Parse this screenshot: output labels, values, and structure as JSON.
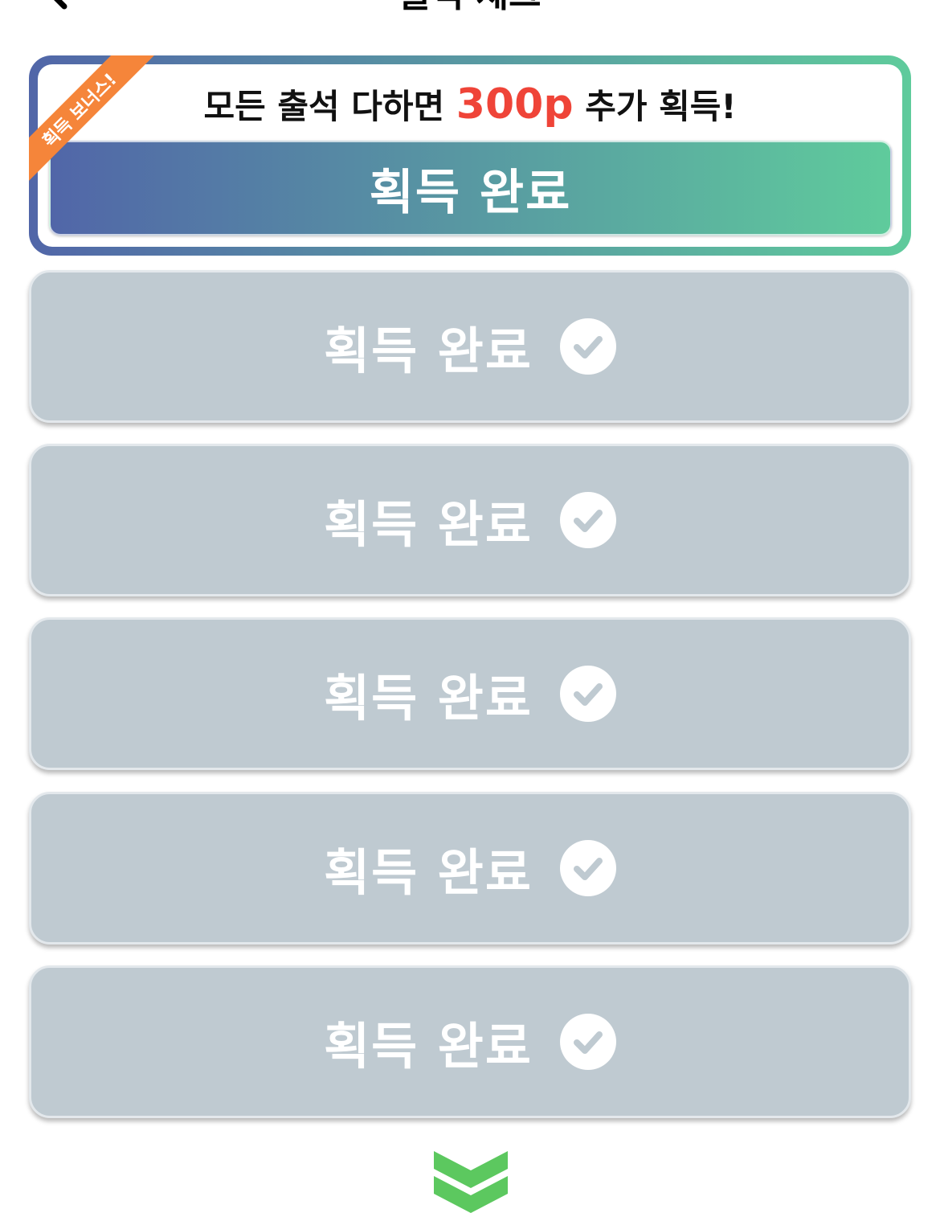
{
  "header": {
    "title": "출석 체크"
  },
  "bonus": {
    "ribbon_label": "획득 보너스!",
    "headline_prefix": "모든 출석 다하면 ",
    "headline_points": "300p",
    "headline_suffix": " 추가 획득!",
    "button_label": "획득 완료"
  },
  "days": [
    {
      "label": "획득 완료",
      "status": "completed",
      "icon": "check-circle-icon"
    },
    {
      "label": "획득 완료",
      "status": "completed",
      "icon": "check-circle-icon"
    },
    {
      "label": "획득 완료",
      "status": "completed",
      "icon": "check-circle-icon"
    },
    {
      "label": "획득 완료",
      "status": "completed",
      "icon": "check-circle-icon"
    },
    {
      "label": "획득 완료",
      "status": "completed",
      "icon": "check-circle-icon"
    }
  ],
  "footer": {
    "icon": "double-chevron-down-icon"
  },
  "colors": {
    "gradient_start": "#5166a8",
    "gradient_end": "#5fcb9c",
    "ribbon": "#f5853a",
    "points": "#ef4438",
    "completed_bg": "#bfcad1",
    "chevron": "#5cc85f"
  }
}
